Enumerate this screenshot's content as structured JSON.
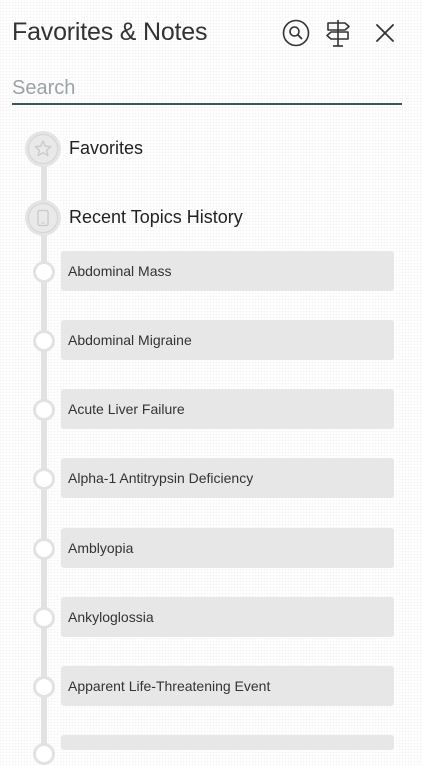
{
  "header": {
    "title": "Favorites & Notes",
    "icons": [
      "search-icon",
      "signpost-icon",
      "close-icon"
    ]
  },
  "search": {
    "placeholder": "Search",
    "value": ""
  },
  "sections": {
    "favorites": {
      "label": "Favorites",
      "icon": "star-icon"
    },
    "history": {
      "label": "Recent Topics History",
      "icon": "tablet-icon"
    }
  },
  "history_items": [
    "Abdominal Mass",
    "Abdominal Migraine",
    "Acute Liver Failure",
    "Alpha-1 Antitrypsin Deficiency",
    "Amblyopia",
    "Ankyloglossia",
    "Apparent Life-Threatening Event"
  ],
  "colors": {
    "accent_underline": "#3d5560",
    "timeline": "#e2e2e2",
    "card_background": "#e7e7e7",
    "icon_stroke": "#333333"
  }
}
